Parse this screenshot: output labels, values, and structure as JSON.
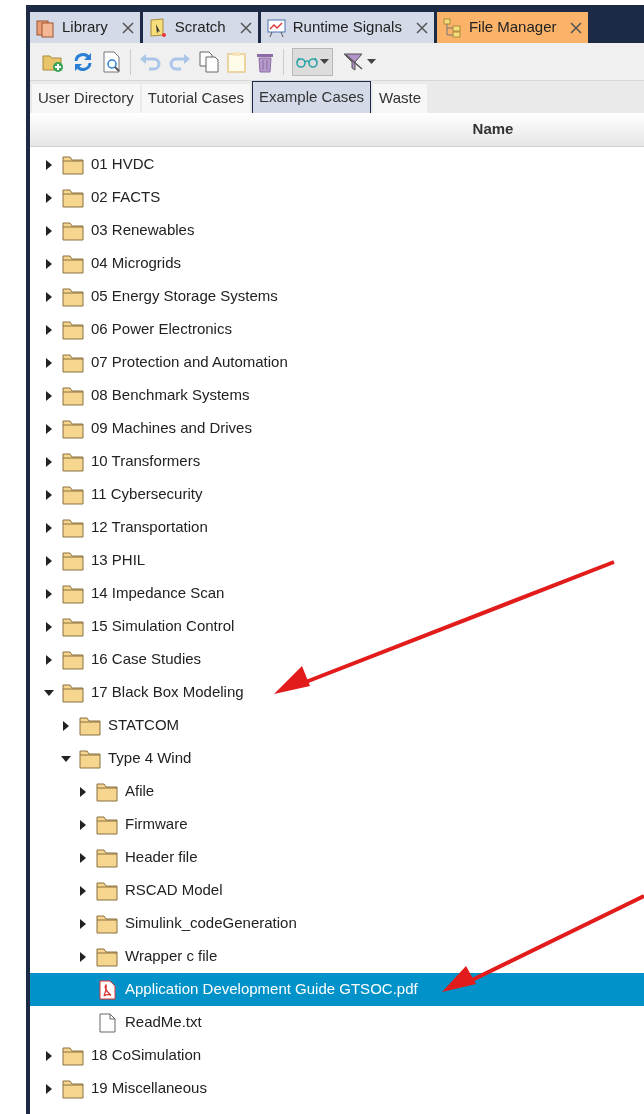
{
  "tabs": [
    {
      "label": "Library",
      "kind": "library",
      "selected": false
    },
    {
      "label": "Scratch",
      "kind": "scratch",
      "selected": false
    },
    {
      "label": "Runtime Signals",
      "kind": "signals",
      "selected": false
    },
    {
      "label": "File Manager",
      "kind": "tree",
      "selected": true
    }
  ],
  "subtabs": [
    {
      "label": "User Directory",
      "selected": false
    },
    {
      "label": "Tutorial Cases",
      "selected": false
    },
    {
      "label": "Example Cases",
      "selected": true
    },
    {
      "label": "Waste",
      "selected": false
    }
  ],
  "column_header": "Name",
  "tree": [
    {
      "name": "01 HVDC",
      "kind": "folder",
      "expanded": false,
      "selected": false
    },
    {
      "name": "02 FACTS",
      "kind": "folder",
      "expanded": false,
      "selected": false
    },
    {
      "name": "03 Renewables",
      "kind": "folder",
      "expanded": false,
      "selected": false
    },
    {
      "name": "04 Microgrids",
      "kind": "folder",
      "expanded": false,
      "selected": false
    },
    {
      "name": "05 Energy Storage Systems",
      "kind": "folder",
      "expanded": false,
      "selected": false
    },
    {
      "name": "06 Power Electronics",
      "kind": "folder",
      "expanded": false,
      "selected": false
    },
    {
      "name": "07 Protection and Automation",
      "kind": "folder",
      "expanded": false,
      "selected": false
    },
    {
      "name": "08 Benchmark Systems",
      "kind": "folder",
      "expanded": false,
      "selected": false
    },
    {
      "name": "09 Machines and Drives",
      "kind": "folder",
      "expanded": false,
      "selected": false
    },
    {
      "name": "10 Transformers",
      "kind": "folder",
      "expanded": false,
      "selected": false
    },
    {
      "name": "11 Cybersecurity",
      "kind": "folder",
      "expanded": false,
      "selected": false
    },
    {
      "name": "12 Transportation",
      "kind": "folder",
      "expanded": false,
      "selected": false
    },
    {
      "name": "13 PHIL",
      "kind": "folder",
      "expanded": false,
      "selected": false
    },
    {
      "name": "14 Impedance Scan",
      "kind": "folder",
      "expanded": false,
      "selected": false
    },
    {
      "name": "15 Simulation Control",
      "kind": "folder",
      "expanded": false,
      "selected": false
    },
    {
      "name": "16 Case Studies",
      "kind": "folder",
      "expanded": false,
      "selected": false
    },
    {
      "name": "17 Black Box Modeling",
      "kind": "folder",
      "expanded": true,
      "selected": false,
      "children": [
        {
          "name": "STATCOM",
          "kind": "folder",
          "expanded": false,
          "selected": false
        },
        {
          "name": "Type 4 Wind",
          "kind": "folder",
          "expanded": true,
          "selected": false,
          "children": [
            {
              "name": "Afile",
              "kind": "folder",
              "expanded": false,
              "selected": false
            },
            {
              "name": "Firmware",
              "kind": "folder",
              "expanded": false,
              "selected": false
            },
            {
              "name": "Header file",
              "kind": "folder",
              "expanded": false,
              "selected": false
            },
            {
              "name": "RSCAD Model",
              "kind": "folder",
              "expanded": false,
              "selected": false
            },
            {
              "name": "Simulink_codeGeneration",
              "kind": "folder",
              "expanded": false,
              "selected": false
            },
            {
              "name": "Wrapper c file",
              "kind": "folder",
              "expanded": false,
              "selected": false
            },
            {
              "name": "Application Development Guide GTSOC.pdf",
              "kind": "pdf",
              "selected": true
            },
            {
              "name": "ReadMe.txt",
              "kind": "text",
              "selected": false
            }
          ]
        }
      ]
    },
    {
      "name": "18 CoSimulation",
      "kind": "folder",
      "expanded": false,
      "selected": false
    },
    {
      "name": "19 Miscellaneous",
      "kind": "folder",
      "expanded": false,
      "selected": false
    }
  ]
}
